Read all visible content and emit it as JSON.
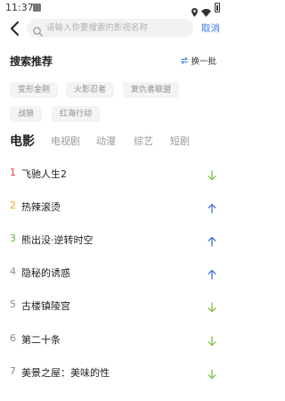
{
  "status": {
    "time": "11:37"
  },
  "search": {
    "placeholder": "请输入你要搜索的影视名称",
    "cancel_label": "取消"
  },
  "recommend": {
    "title": "搜索推荐",
    "refresh_label": "换一批",
    "tags": [
      "变形金刚",
      "火影忍者",
      "复仇者联盟",
      "战狼",
      "红海行动"
    ]
  },
  "tabs": [
    "电影",
    "电视剧",
    "动漫",
    "综艺",
    "短剧"
  ],
  "active_tab": "电影",
  "ranking": [
    {
      "rank": "1",
      "title": "飞驰人生2",
      "trend": "down"
    },
    {
      "rank": "2",
      "title": "热辣滚烫",
      "trend": "up"
    },
    {
      "rank": "3",
      "title": "熊出没·逆转时空",
      "trend": "up"
    },
    {
      "rank": "4",
      "title": "隐秘的诱惑",
      "trend": "up"
    },
    {
      "rank": "5",
      "title": "古楼镇陵宫",
      "trend": "down"
    },
    {
      "rank": "6",
      "title": "第二十条",
      "trend": "down"
    },
    {
      "rank": "7",
      "title": "美景之屋：美味的性",
      "trend": "down"
    }
  ],
  "colors": {
    "accent": "#2f78e8",
    "rank_1": "#e83b3b",
    "rank_2": "#f2a21d",
    "rank_3": "#5cb83a",
    "rank_other": "#8a8a8a",
    "trend_up": "#3e6fe0",
    "trend_down": "#7bc043"
  }
}
